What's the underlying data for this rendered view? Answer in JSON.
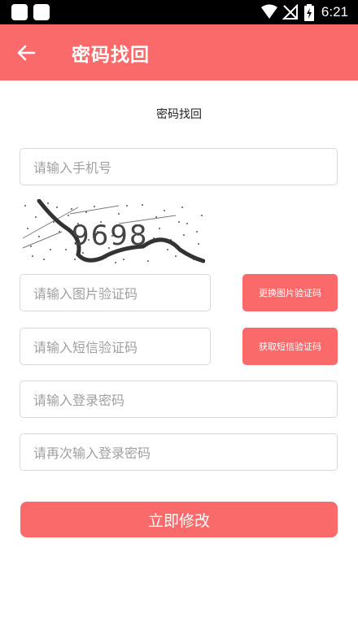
{
  "status_bar": {
    "time": "6:21"
  },
  "app_bar": {
    "title": "密码找回"
  },
  "page": {
    "heading": "密码找回"
  },
  "form": {
    "phone_placeholder": "请输入手机号",
    "captcha_text": "9698",
    "image_code_placeholder": "请输入图片验证码",
    "refresh_image_label": "更换图片验证码",
    "sms_code_placeholder": "请输入短信验证码",
    "get_sms_label": "获取短信验证码",
    "password_placeholder": "请输入登录密码",
    "confirm_password_placeholder": "请再次输入登录密码",
    "submit_label": "立即修改"
  },
  "colors": {
    "accent": "#fb6a6a",
    "status_bar": "#000000",
    "border": "#d9d9d9"
  }
}
